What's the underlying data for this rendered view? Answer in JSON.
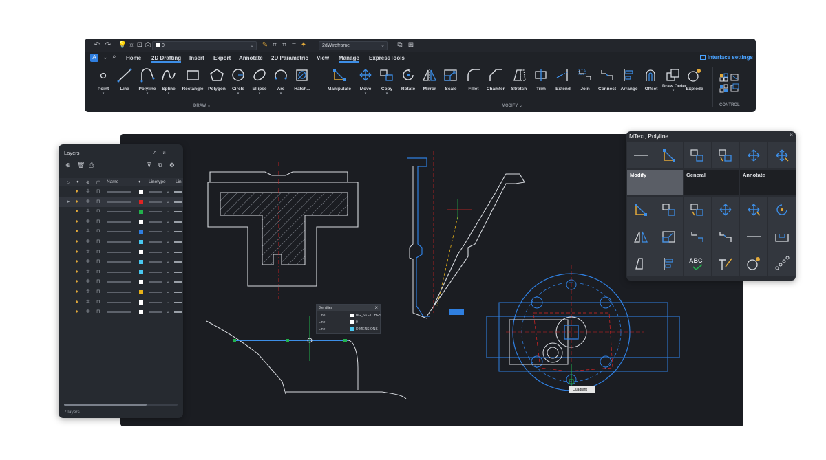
{
  "qat": {
    "layer_value": "0",
    "visual_style": "2dWireframe"
  },
  "ribbon": {
    "app_letter": "A",
    "tabs": [
      "Home",
      "2D Drafting",
      "Insert",
      "Export",
      "Annotate",
      "2D Parametric",
      "View",
      "Manage",
      "ExpressTools"
    ],
    "interface_settings": "Interface settings",
    "draw_tools": [
      "Point",
      "Line",
      "Polyline",
      "Spline",
      "Rectangle",
      "Polygon",
      "Circle",
      "Ellipse",
      "Arc",
      "Hatch..."
    ],
    "modify_tools": [
      "Manipulate",
      "Move",
      "Copy",
      "Rotate",
      "Mirror",
      "Scale",
      "Fillet",
      "Chamfer",
      "Stretch",
      "Trim",
      "Extend",
      "Join",
      "Connect",
      "Arrange",
      "Offset",
      "Draw Order",
      "Explode"
    ],
    "panel_draw": "DRAW",
    "panel_modify": "MODIFY",
    "panel_control": "CONTROL"
  },
  "layers": {
    "title": "Layers",
    "col_name": "Name",
    "col_linetype": "Linetype",
    "col_lw": "Lin",
    "footer": "7 layers",
    "rows": [
      {
        "color": "#ffffff"
      },
      {
        "color": "#e02424"
      },
      {
        "color": "#22b14c"
      },
      {
        "color": "#ffffff"
      },
      {
        "color": "#2f7fe0"
      },
      {
        "color": "#4ac8f0"
      },
      {
        "color": "#ffffff"
      },
      {
        "color": "#4ac8f0"
      },
      {
        "color": "#4ac8f0"
      },
      {
        "color": "#ffffff"
      },
      {
        "color": "#e8b31a"
      },
      {
        "color": "#ffffff"
      },
      {
        "color": "#ffffff"
      }
    ]
  },
  "quad": {
    "title": "MText, Polyline",
    "tab_modify": "Modify",
    "tab_general": "General",
    "tab_annotate": "Annotate"
  },
  "props": {
    "header": "3 entities",
    "rows": [
      {
        "type": "Line",
        "layer": "BG_SKETCHES",
        "color": "#ffffff"
      },
      {
        "type": "Line",
        "layer": "0",
        "color": "#ffffff"
      },
      {
        "type": "Line",
        "layer": "DIMENSIONS",
        "color": "#4ac8f0"
      }
    ]
  },
  "snap_label": "Quadrant",
  "colors": {
    "accent": "#3d8ee6",
    "drawing_blue": "#2f7fe0",
    "drawing_white": "#d8dbe0",
    "drawing_red": "#e02424",
    "snap_green": "#22b14c"
  }
}
